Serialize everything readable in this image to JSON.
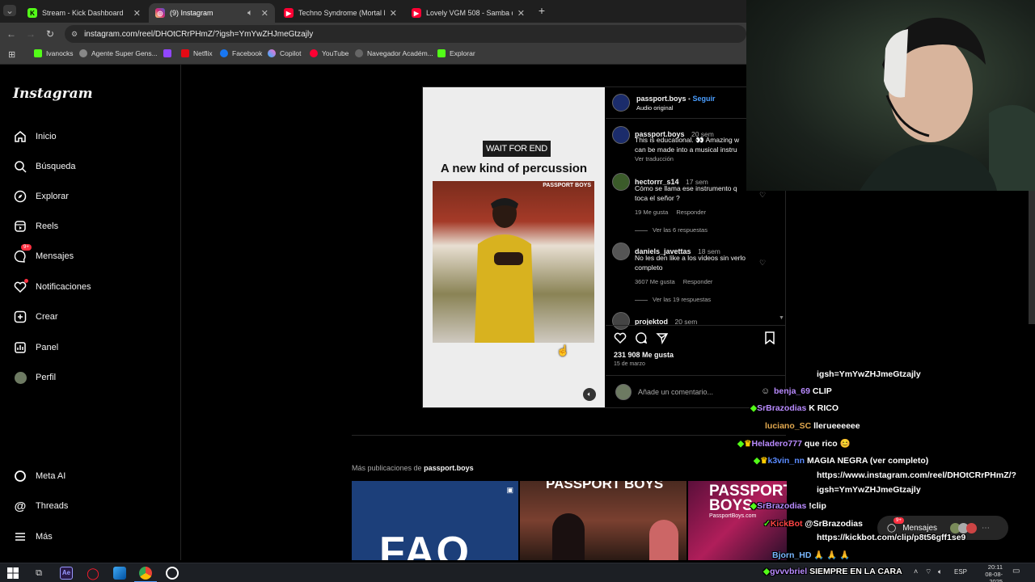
{
  "browser": {
    "tabs": [
      {
        "label": "Stream - Kick Dashboard",
        "icon": "kick-icon",
        "color": "#53fc18"
      },
      {
        "label": "(9) Instagram",
        "icon": "instagram-icon",
        "color": "#e1306c"
      },
      {
        "label": "Techno Syndrome (Mortal Komb",
        "icon": "youtube-icon",
        "color": "#ff0033"
      },
      {
        "label": "Lovely VGM 508 - Samba de Am",
        "icon": "youtube-icon",
        "color": "#ff0033"
      }
    ],
    "url": "instagram.com/reel/DHOtCRrPHmZ/?igsh=YmYwZHJmeGtzajly",
    "bookmarks": [
      "Ivanocks",
      "Agente Super Gens...",
      "",
      "Netflix",
      "Facebook",
      "Copilot",
      "YouTube",
      "Navegador Académ...",
      "Explorar"
    ]
  },
  "instagram": {
    "logo": "Instagram",
    "nav": [
      "Inicio",
      "Búsqueda",
      "Explorar",
      "Reels",
      "Mensajes",
      "Notificaciones",
      "Crear",
      "Panel",
      "Perfil"
    ],
    "messages_badge": "9+",
    "bottom_nav": [
      "Meta AI",
      "Threads",
      "Más"
    ],
    "reel": {
      "banner": "WAIT FOR END",
      "title": "A new kind of percussion",
      "watermark": "PASSPORT BOYS"
    },
    "post": {
      "author": "passport.boys",
      "follow": "Seguir",
      "separator": "•",
      "audio": "Audio original",
      "caption": {
        "user": "passport.boys",
        "time": "20 sem",
        "text1": "This is educational. 👀 Amazing w",
        "text2": "can be made into a musical instru",
        "translate": "Ver traducción"
      },
      "comments": [
        {
          "user": "hectorrr_s14",
          "time": "17 sem",
          "text1": "Cómo se llama ese instrumento q",
          "text2": "toca el señor ?",
          "likes": "19 Me gusta",
          "reply": "Responder",
          "replies": "Ver las 6 respuestas"
        },
        {
          "user": "daniels_javettas",
          "time": "18 sem",
          "text1": "No les den like a los videos sin verlo",
          "text2": "completo",
          "likes": "3607 Me gusta",
          "reply": "Responder",
          "replies": "Ver las 19 respuestas"
        },
        {
          "user": "projektod",
          "time": "20 sem"
        }
      ],
      "like_count": "231 908 Me gusta",
      "date": "15 de marzo",
      "comment_placeholder": "Añade un comentario..."
    },
    "more_posts_prefix": "Más publicaciones de",
    "more_posts_user": "passport.boys",
    "grid_texts": [
      "FAQ",
      "PASSPORT BOYS",
      "PASSPORT BOYS",
      "PassportBoys.com"
    ],
    "messages_pill": "Mensajes",
    "messages_pill_badge": "9+"
  },
  "chat": [
    {
      "user": "",
      "msg": "igsh=YmYwZHJmeGtzajly",
      "color": "#ffffff"
    },
    {
      "user": "benja_69",
      "msg": "CLIP",
      "color": "#b98bff"
    },
    {
      "user": "SrBrazodias",
      "msg": "K RICO",
      "color": "#b98bff"
    },
    {
      "user": "luciano_SC",
      "msg": "lleгueeeeee",
      "color": "#e3a94f"
    },
    {
      "user": "Heladero777",
      "msg": "que rico 😊",
      "color": "#b98bff"
    },
    {
      "user": "k3vin_nn",
      "msg": "MAGIA NEGRA (ver completo)",
      "color": "#5a8bff"
    },
    {
      "user": "",
      "msg": "https://www.instagram.com/reel/DHOtCRrPHmZ/?",
      "color": "#ffffff"
    },
    {
      "user": "",
      "msg": "igsh=YmYwZHJmeGtzajly",
      "color": "#ffffff"
    },
    {
      "user": "SrBrazodias",
      "msg": "!clip",
      "color": "#b98bff"
    },
    {
      "user": "KickBot",
      "msg": "@SrBrazodias",
      "color": "#ff4444"
    },
    {
      "user": "",
      "msg": "https://kickbot.com/clip/p8t56gff1se9",
      "color": "#ffffff"
    },
    {
      "user": "Bjorn_HD",
      "msg": "🙏 🙏 🙏",
      "color": "#7ab8ff"
    },
    {
      "user": "gvvvbriel",
      "msg": "SIEMPRE EN LA CARA",
      "color": "#b98bff"
    }
  ],
  "taskbar": {
    "lang": "ESP",
    "time": "20:11",
    "date": "08-08-2025"
  }
}
